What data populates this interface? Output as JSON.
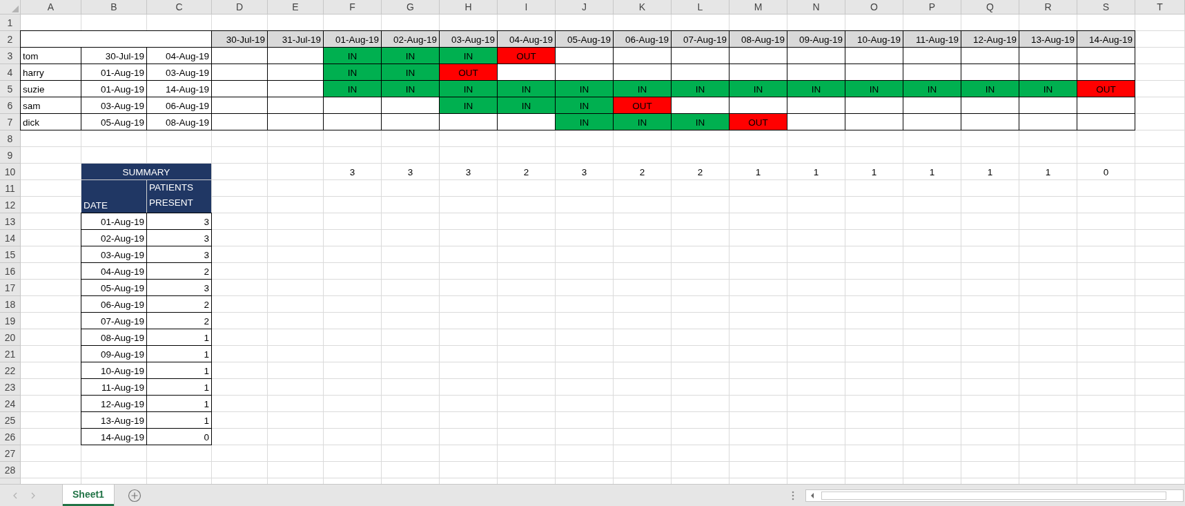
{
  "column_headers": [
    "A",
    "B",
    "C",
    "D",
    "E",
    "F",
    "G",
    "H",
    "I",
    "J",
    "K",
    "L",
    "M",
    "N",
    "O",
    "P",
    "Q",
    "R",
    "S",
    "T"
  ],
  "row_headers": [
    "1",
    "2",
    "3",
    "4",
    "5",
    "6",
    "7",
    "8",
    "9",
    "10",
    "11",
    "12",
    "13",
    "14",
    "15",
    "16",
    "17",
    "18",
    "19",
    "20",
    "21",
    "22",
    "23",
    "24",
    "25",
    "26",
    "27",
    "28"
  ],
  "date_headers": [
    "30-Jul-19",
    "31-Jul-19",
    "01-Aug-19",
    "02-Aug-19",
    "03-Aug-19",
    "04-Aug-19",
    "05-Aug-19",
    "06-Aug-19",
    "07-Aug-19",
    "08-Aug-19",
    "09-Aug-19",
    "10-Aug-19",
    "11-Aug-19",
    "12-Aug-19",
    "13-Aug-19",
    "14-Aug-19"
  ],
  "patients": [
    {
      "name": "tom",
      "start": "30-Jul-19",
      "end": "04-Aug-19",
      "days": [
        {
          "text": "IN",
          "kind": "in"
        },
        {
          "text": "IN",
          "kind": "in"
        },
        {
          "text": "IN",
          "kind": "in"
        },
        {
          "text": "OUT",
          "kind": "out"
        },
        {
          "kind": "empty"
        },
        {
          "kind": "empty"
        },
        {
          "kind": "empty"
        },
        {
          "kind": "empty"
        },
        {
          "kind": "empty"
        },
        {
          "kind": "empty"
        },
        {
          "kind": "empty"
        },
        {
          "kind": "empty"
        },
        {
          "kind": "empty"
        },
        {
          "kind": "empty"
        }
      ]
    },
    {
      "name": "harry",
      "start": "01-Aug-19",
      "end": "03-Aug-19",
      "days": [
        {
          "text": "IN",
          "kind": "in"
        },
        {
          "text": "IN",
          "kind": "in"
        },
        {
          "text": "OUT",
          "kind": "out"
        },
        {
          "kind": "empty"
        },
        {
          "kind": "empty"
        },
        {
          "kind": "empty"
        },
        {
          "kind": "empty"
        },
        {
          "kind": "empty"
        },
        {
          "kind": "empty"
        },
        {
          "kind": "empty"
        },
        {
          "kind": "empty"
        },
        {
          "kind": "empty"
        },
        {
          "kind": "empty"
        },
        {
          "kind": "empty"
        }
      ]
    },
    {
      "name": "suzie",
      "start": "01-Aug-19",
      "end": "14-Aug-19",
      "days": [
        {
          "text": "IN",
          "kind": "in"
        },
        {
          "text": "IN",
          "kind": "in"
        },
        {
          "text": "IN",
          "kind": "in"
        },
        {
          "text": "IN",
          "kind": "in"
        },
        {
          "text": "IN",
          "kind": "in"
        },
        {
          "text": "IN",
          "kind": "in"
        },
        {
          "text": "IN",
          "kind": "in"
        },
        {
          "text": "IN",
          "kind": "in"
        },
        {
          "text": "IN",
          "kind": "in"
        },
        {
          "text": "IN",
          "kind": "in"
        },
        {
          "text": "IN",
          "kind": "in"
        },
        {
          "text": "IN",
          "kind": "in"
        },
        {
          "text": "IN",
          "kind": "in"
        },
        {
          "text": "OUT",
          "kind": "out"
        }
      ]
    },
    {
      "name": "sam",
      "start": "03-Aug-19",
      "end": "06-Aug-19",
      "days": [
        {
          "kind": "empty"
        },
        {
          "kind": "empty"
        },
        {
          "text": "IN",
          "kind": "in"
        },
        {
          "text": "IN",
          "kind": "in"
        },
        {
          "text": "IN",
          "kind": "in"
        },
        {
          "text": "OUT",
          "kind": "out"
        },
        {
          "kind": "empty"
        },
        {
          "kind": "empty"
        },
        {
          "kind": "empty"
        },
        {
          "kind": "empty"
        },
        {
          "kind": "empty"
        },
        {
          "kind": "empty"
        },
        {
          "kind": "empty"
        },
        {
          "kind": "empty"
        }
      ]
    },
    {
      "name": "dick",
      "start": "05-Aug-19",
      "end": "08-Aug-19",
      "days": [
        {
          "kind": "empty"
        },
        {
          "kind": "empty"
        },
        {
          "kind": "empty"
        },
        {
          "kind": "empty"
        },
        {
          "text": "IN",
          "kind": "in"
        },
        {
          "text": "IN",
          "kind": "in"
        },
        {
          "text": "IN",
          "kind": "in"
        },
        {
          "text": "OUT",
          "kind": "out"
        },
        {
          "kind": "empty"
        },
        {
          "kind": "empty"
        },
        {
          "kind": "empty"
        },
        {
          "kind": "empty"
        },
        {
          "kind": "empty"
        },
        {
          "kind": "empty"
        }
      ]
    }
  ],
  "daily_counts": [
    "3",
    "3",
    "3",
    "2",
    "3",
    "2",
    "2",
    "1",
    "1",
    "1",
    "1",
    "1",
    "1",
    "0"
  ],
  "summary": {
    "title": "SUMMARY",
    "date_header": "DATE",
    "count_header": "PATIENTS PRESENT",
    "rows": [
      {
        "date": "01-Aug-19",
        "count": "3"
      },
      {
        "date": "02-Aug-19",
        "count": "3"
      },
      {
        "date": "03-Aug-19",
        "count": "3"
      },
      {
        "date": "04-Aug-19",
        "count": "2"
      },
      {
        "date": "05-Aug-19",
        "count": "3"
      },
      {
        "date": "06-Aug-19",
        "count": "2"
      },
      {
        "date": "07-Aug-19",
        "count": "2"
      },
      {
        "date": "08-Aug-19",
        "count": "1"
      },
      {
        "date": "09-Aug-19",
        "count": "1"
      },
      {
        "date": "10-Aug-19",
        "count": "1"
      },
      {
        "date": "11-Aug-19",
        "count": "1"
      },
      {
        "date": "12-Aug-19",
        "count": "1"
      },
      {
        "date": "13-Aug-19",
        "count": "1"
      },
      {
        "date": "14-Aug-19",
        "count": "0"
      }
    ]
  },
  "sheet_tabs": [
    {
      "label": "Sheet1",
      "selected": true
    }
  ]
}
